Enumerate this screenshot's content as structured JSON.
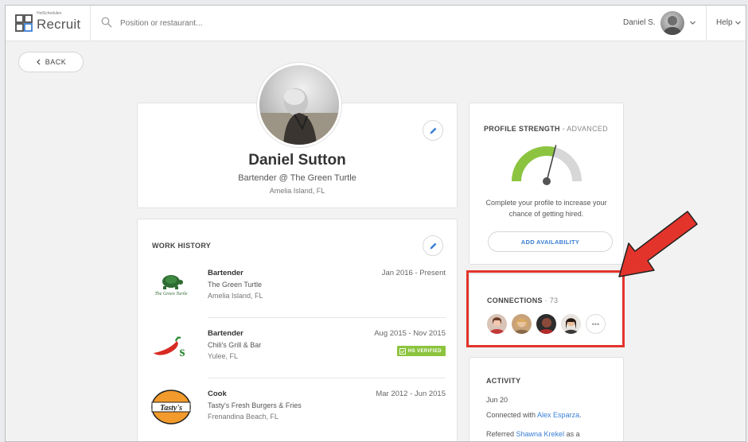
{
  "app": {
    "brand_name": "Recruit",
    "brand_small": "HotSchedules"
  },
  "topbar": {
    "search_placeholder": "Position or restaurant...",
    "user_name": "Daniel S.",
    "help_label": "Help"
  },
  "back_label": "BACK",
  "profile": {
    "name": "Daniel Sutton",
    "title": "Bartender @ The Green Turtle",
    "location": "Amelia Island, FL"
  },
  "work_history": {
    "title": "WORK HISTORY",
    "jobs": [
      {
        "role": "Bartender",
        "company": "The Green Turtle",
        "location": "Amelia Island, FL",
        "dates": "Jan 2016 - Present",
        "logo": "green-turtle-logo"
      },
      {
        "role": "Bartender",
        "company": "Chili's Grill & Bar",
        "location": "Yulee, FL",
        "dates": "Aug 2015 - Nov 2015",
        "verified": "HS VERIFIED",
        "logo": "chilis-logo"
      },
      {
        "role": "Cook",
        "company": "Tasty's Fresh Burgers & Fries",
        "location": "Frenandina Beach, FL",
        "dates": "Mar 2012 - Jun 2015",
        "logo": "tastys-logo"
      }
    ]
  },
  "profile_strength": {
    "title": "PROFILE STRENGTH",
    "level": "ADVANCED",
    "level_fraction": 0.58,
    "message": "Complete your profile to increase your chance of getting hired.",
    "button_label": "ADD AVAILABILITY"
  },
  "connections": {
    "title": "CONNECTIONS",
    "count": "73",
    "more_label": "•••"
  },
  "activity": {
    "title": "ACTIVITY",
    "date": "Jun 20",
    "items": [
      {
        "prefix": "Connected with ",
        "link": "Alex Esparza",
        "suffix": "."
      },
      {
        "prefix": "Referred ",
        "link": "Shawna Krekel",
        "suffix": " as a"
      }
    ]
  },
  "colors": {
    "accent": "#3a7fd5",
    "gauge_fill": "#8cc43f",
    "gauge_track": "#d7d7d7",
    "highlight": "#e3342b",
    "verified": "#8cc43f"
  }
}
